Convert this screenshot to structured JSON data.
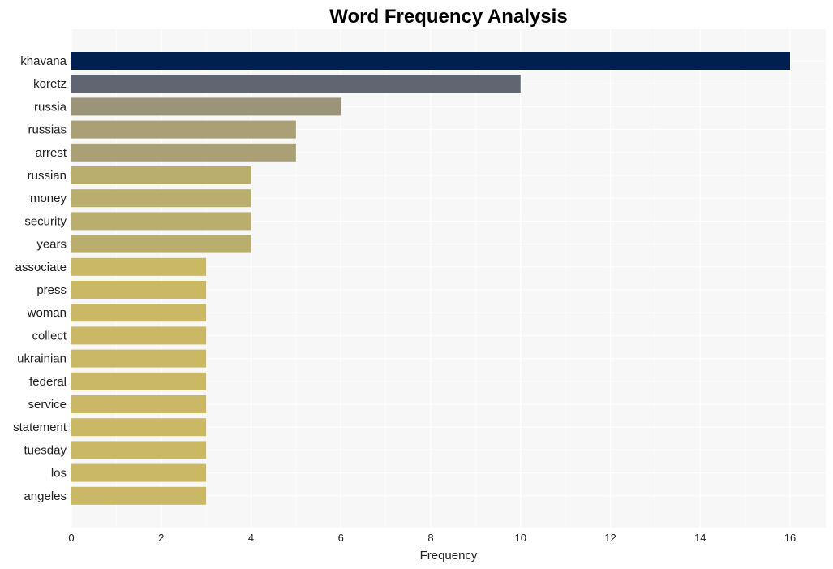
{
  "chart_data": {
    "type": "bar",
    "orientation": "horizontal",
    "title": "Word Frequency Analysis",
    "xlabel": "Frequency",
    "ylabel": "",
    "xlim": [
      0,
      16.8
    ],
    "xticks": [
      0,
      2,
      4,
      6,
      8,
      10,
      12,
      14,
      16
    ],
    "grid": true,
    "legend": "none",
    "categories": [
      "khavana",
      "koretz",
      "russia",
      "russias",
      "arrest",
      "russian",
      "money",
      "security",
      "years",
      "associate",
      "press",
      "woman",
      "collect",
      "ukrainian",
      "federal",
      "service",
      "statement",
      "tuesday",
      "los",
      "angeles"
    ],
    "values": [
      16,
      10,
      6,
      5,
      5,
      4,
      4,
      4,
      4,
      3,
      3,
      3,
      3,
      3,
      3,
      3,
      3,
      3,
      3,
      3
    ],
    "colors": [
      "#00204f",
      "#616572",
      "#9b9479",
      "#ab9f75",
      "#ab9f75",
      "#baae6f",
      "#baae6f",
      "#baae6f",
      "#baae6f",
      "#cbb866",
      "#cbb866",
      "#cbb866",
      "#cbb866",
      "#cbb866",
      "#cbb866",
      "#cbb866",
      "#cbb866",
      "#cbb866",
      "#cbb866",
      "#cbb866"
    ]
  }
}
